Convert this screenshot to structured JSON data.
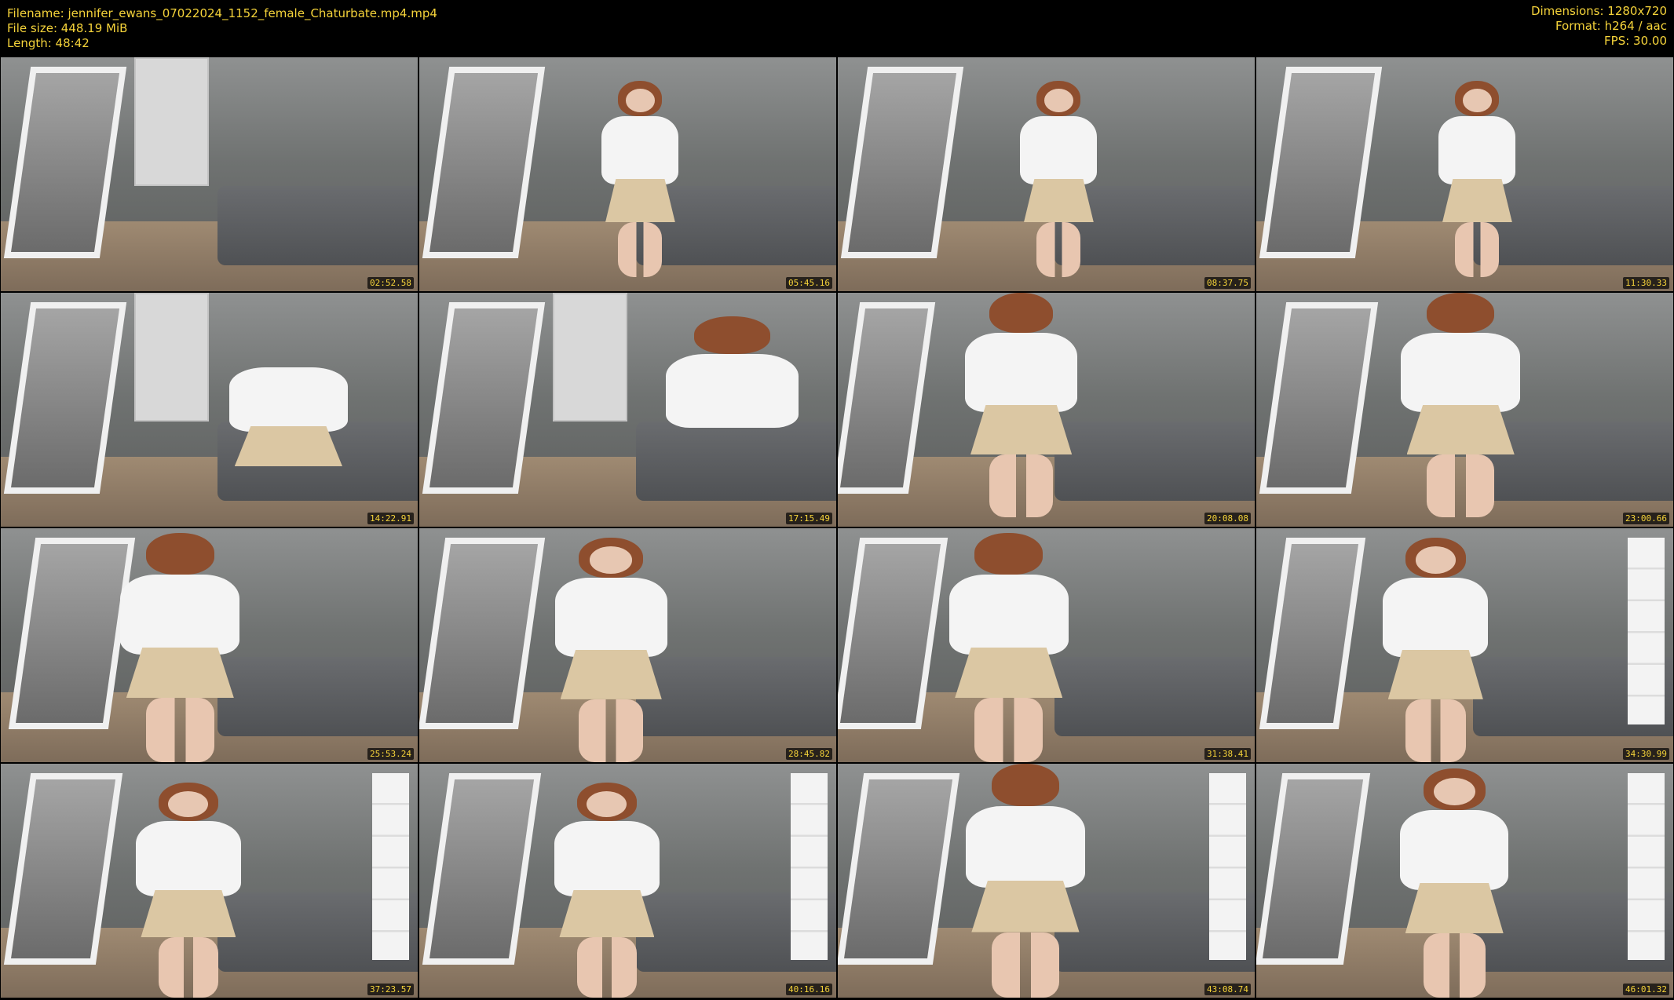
{
  "header": {
    "filename": "Filename: jennifer_ewans_07022024_1152_female_Chaturbate.mp4.mp4",
    "file_size": "File size: 448.19 MiB",
    "length": "Length: 48:42",
    "dimensions": "Dimensions: 1280x720",
    "format": "Format: h264 / aac",
    "fps": "FPS: 30.00"
  },
  "thumbnails": [
    {
      "timestamp": "02:52.58"
    },
    {
      "timestamp": "05:45.16"
    },
    {
      "timestamp": "08:37.75"
    },
    {
      "timestamp": "11:30.33"
    },
    {
      "timestamp": "14:22.91"
    },
    {
      "timestamp": "17:15.49"
    },
    {
      "timestamp": "20:08.08"
    },
    {
      "timestamp": "23:00.66"
    },
    {
      "timestamp": "25:53.24"
    },
    {
      "timestamp": "28:45.82"
    },
    {
      "timestamp": "31:38.41"
    },
    {
      "timestamp": "34:30.99"
    },
    {
      "timestamp": "37:23.57"
    },
    {
      "timestamp": "40:16.16"
    },
    {
      "timestamp": "43:08.74"
    },
    {
      "timestamp": "46:01.32"
    }
  ]
}
